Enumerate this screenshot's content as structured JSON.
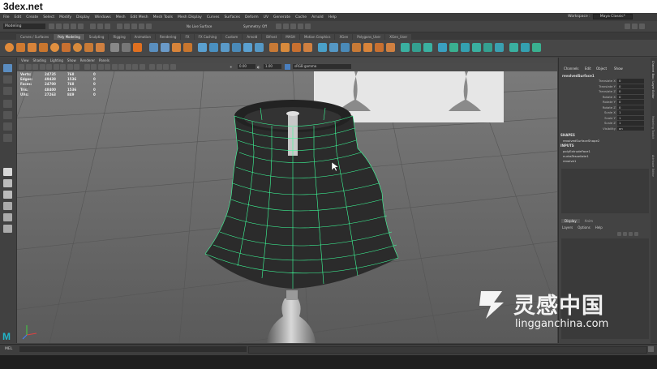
{
  "site": {
    "logo": "3dex.net"
  },
  "menubar": {
    "items": [
      "File",
      "Edit",
      "Create",
      "Select",
      "Modify",
      "Display",
      "Windows",
      "Mesh",
      "Edit Mesh",
      "Mesh Tools",
      "Mesh Display",
      "Curves",
      "Surfaces",
      "Deform",
      "UV",
      "Generate",
      "Cache",
      "Arnold",
      "Help"
    ],
    "workspace_label": "Workspace :",
    "workspace_value": "Maya Classic*"
  },
  "statusline": {
    "mode": "Modeling",
    "live_surface": "No Live Surface",
    "symmetry": "Symmetry: Off"
  },
  "shelf": {
    "tabs": [
      "Curves / Surfaces",
      "Poly Modeling",
      "Sculpting",
      "Rigging",
      "Animation",
      "Rendering",
      "FX",
      "FX Caching",
      "Custom",
      "Arnold",
      "Bifrost",
      "MASH",
      "Motion Graphics",
      "XGen",
      "Polygons_User",
      "XGen_User"
    ],
    "active_tab": "Poly Modeling"
  },
  "viewport": {
    "menu": [
      "View",
      "Shading",
      "Lighting",
      "Show",
      "Renderer",
      "Panels"
    ],
    "exposure": "0.00",
    "gamma": "1.00",
    "color_space": "sRGB gamma",
    "hud": [
      {
        "label": "Verts:",
        "a": "24735",
        "b": "768",
        "c": "0"
      },
      {
        "label": "Edges:",
        "a": "49438",
        "b": "1536",
        "c": "0"
      },
      {
        "label": "Faces:",
        "a": "24700",
        "b": "768",
        "c": "0"
      },
      {
        "label": "Tris:",
        "a": "48400",
        "b": "1536",
        "c": "0"
      },
      {
        "label": "UVs:",
        "a": "27263",
        "b": "849",
        "c": "0"
      }
    ]
  },
  "channel_box": {
    "menu": [
      "Channels",
      "Edit",
      "Object",
      "Show"
    ],
    "object": "revolvedSurface1",
    "attributes": [
      {
        "label": "Translate X",
        "value": "0"
      },
      {
        "label": "Translate Y",
        "value": "0"
      },
      {
        "label": "Translate Z",
        "value": "0"
      },
      {
        "label": "Rotate X",
        "value": "0"
      },
      {
        "label": "Rotate Y",
        "value": "0"
      },
      {
        "label": "Rotate Z",
        "value": "0"
      },
      {
        "label": "Scale X",
        "value": "1"
      },
      {
        "label": "Scale Y",
        "value": "1"
      },
      {
        "label": "Scale Z",
        "value": "1"
      },
      {
        "label": "Visibility",
        "value": "on"
      }
    ],
    "shapes_header": "SHAPES",
    "shape": "revolvedSurfaceShape2",
    "inputs_header": "INPUTS",
    "inputs": [
      "polyExtrudeFace1",
      "nurbsTessellate1",
      "revolve1"
    ]
  },
  "layer_editor": {
    "tabs": [
      "Display",
      "Anim"
    ],
    "menu": [
      "Layers",
      "Options",
      "Help"
    ]
  },
  "side_tabs": [
    "Channel Box / Layer Editor",
    "Modeling Toolkit",
    "Attribute Editor"
  ],
  "command_line": {
    "label": "MEL"
  },
  "watermark": {
    "title": "灵感中国",
    "url": "lingganchina.com"
  },
  "colors": {
    "wire": "#3dff9a",
    "accent": "#21b5c8"
  }
}
